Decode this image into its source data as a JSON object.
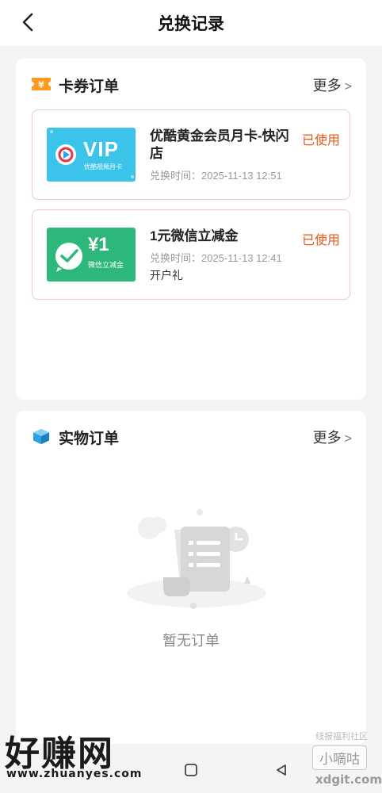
{
  "header": {
    "title": "兑换记录"
  },
  "card_section": {
    "title": "卡券订单",
    "more_label": "更多",
    "orders": [
      {
        "thumb_title": "VIP",
        "thumb_sub": "优酷视频月卡",
        "name": "优酷黄金会员月卡-快闪店",
        "time": "兑换时间：2025-11-13 12:51",
        "extra": "",
        "status": "已使用"
      },
      {
        "thumb_title": "¥1",
        "thumb_sub": "微信立减金",
        "name": "1元微信立减金",
        "time": "兑换时间：2025-11-13 12:41",
        "extra": "开户礼",
        "status": "已使用"
      }
    ]
  },
  "physical_section": {
    "title": "实物订单",
    "more_label": "更多",
    "empty_text": "暂无订单"
  },
  "watermarks": {
    "left_big": "好赚网",
    "left_url": "www.zhuanyes.com",
    "right_top": "线报福利社区",
    "right_badge": "小嘀咕",
    "right_url": "xdgit.com"
  },
  "colors": {
    "status": "#e45a1a",
    "accent_orange": "#ff9a1e",
    "vip_blue": "#3cc3ea",
    "wx_green": "#2db77a"
  }
}
